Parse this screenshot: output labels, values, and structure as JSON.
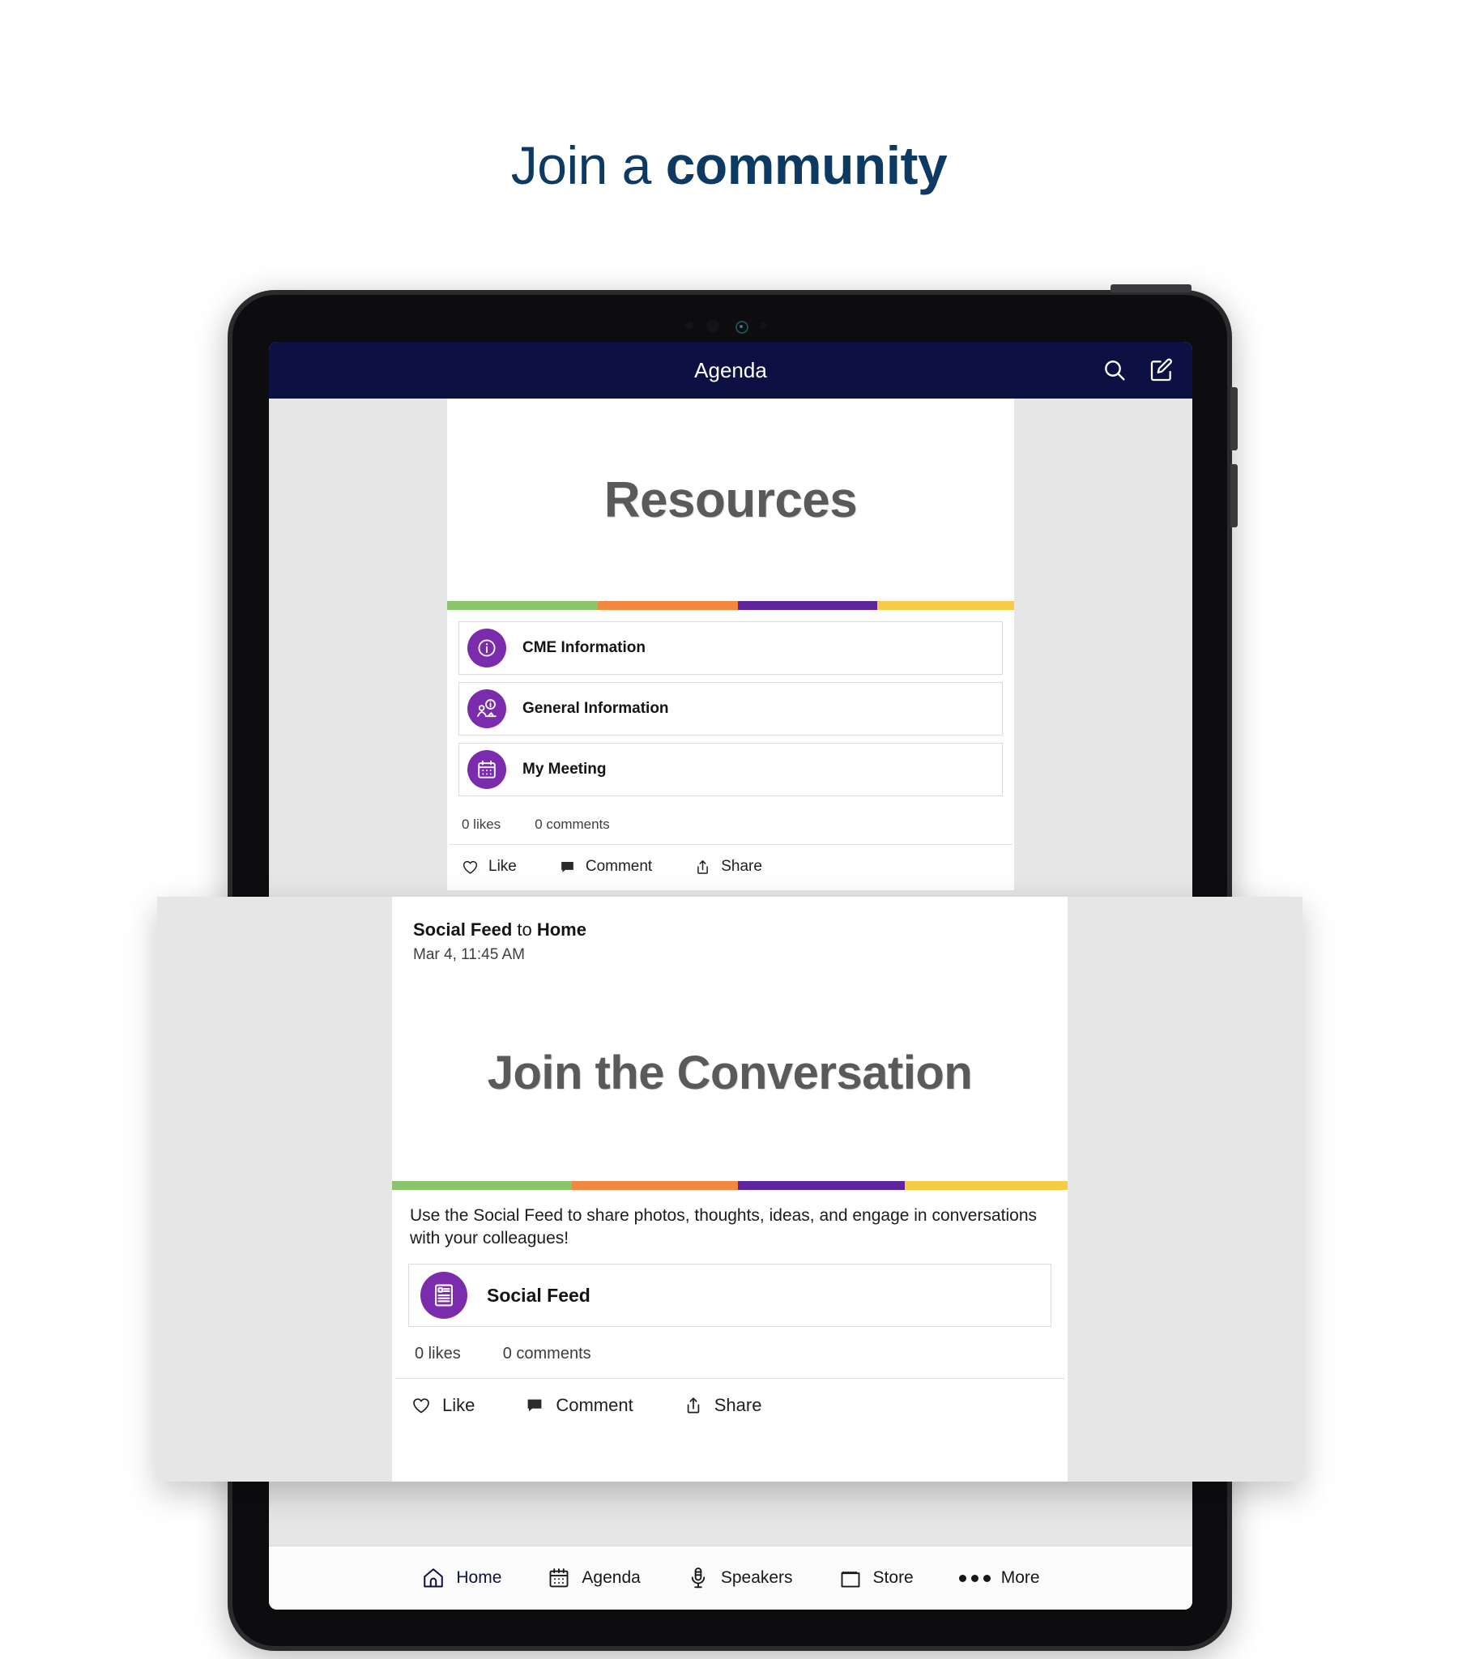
{
  "headline": {
    "regular": "Join a ",
    "bold": "community",
    "color": "#0d3a63"
  },
  "device": {
    "type": "tablet",
    "camera": "front-camera"
  },
  "app": {
    "header": {
      "title": "Agenda",
      "background": "#0d1042",
      "actions": [
        {
          "name": "search-icon",
          "label": "Search"
        },
        {
          "name": "compose-icon",
          "label": "Compose"
        }
      ]
    },
    "accent_stripe": [
      "#8cc46c",
      "#f0883f",
      "#5f259f",
      "#f7cb46"
    ],
    "icon_circle_color": "#7b2cad",
    "post": {
      "hero_title": "Resources",
      "links": [
        {
          "label": "CME Information",
          "icon": "info-circle-icon"
        },
        {
          "label": "General Information",
          "icon": "person-info-icon"
        },
        {
          "label": "My Meeting",
          "icon": "calendar-icon"
        }
      ],
      "likes": "0 likes",
      "comments": "0 comments",
      "actions": [
        {
          "label": "Like",
          "icon": "heart-icon"
        },
        {
          "label": "Comment",
          "icon": "comment-icon"
        },
        {
          "label": "Share",
          "icon": "share-icon"
        }
      ]
    },
    "bottom_nav": [
      {
        "label": "Home",
        "icon": "home-icon",
        "active": true
      },
      {
        "label": "Agenda",
        "icon": "calendar-icon",
        "active": false
      },
      {
        "label": "Speakers",
        "icon": "microphone-icon",
        "active": false
      },
      {
        "label": "Store",
        "icon": "storefront-icon",
        "active": false
      },
      {
        "label": "More",
        "icon": "ellipsis-icon",
        "active": false
      }
    ]
  },
  "overlay": {
    "author": "Social Feed",
    "preposition": " to ",
    "target": "Home",
    "timestamp": "Mar 4, 11:45 AM",
    "hero_title": "Join the Conversation",
    "description": "Use the Social Feed to share photos, thoughts, ideas, and engage in conversations with your colleagues!",
    "link": {
      "label": "Social Feed",
      "icon": "feed-article-icon"
    },
    "likes": "0 likes",
    "comments": "0 comments",
    "actions": [
      {
        "label": "Like",
        "icon": "heart-icon"
      },
      {
        "label": "Comment",
        "icon": "comment-icon"
      },
      {
        "label": "Share",
        "icon": "share-icon"
      }
    ]
  }
}
